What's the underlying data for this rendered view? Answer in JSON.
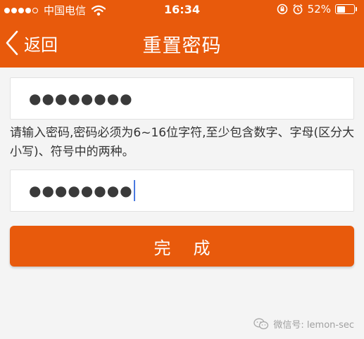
{
  "status_bar": {
    "carrier": "中国电信",
    "time": "16:34",
    "battery_text": "52%",
    "battery_level": 0.52,
    "signal_bars": 4,
    "signal_total": 5
  },
  "nav": {
    "back_label": "返回",
    "title": "重置密码"
  },
  "form": {
    "password_value": "●●●●●●●●",
    "confirm_value": "●●●●●●●●",
    "hint": "请输入密码,密码必须为6~16位字符,至少包含数字、字母(区分大小写)、符号中的两种。",
    "submit_label": "完成"
  },
  "watermark": {
    "text": "微信号: lemon-sec"
  },
  "colors": {
    "accent": "#e85a0c",
    "background": "#f4f4f4",
    "caret": "#4a7ae0"
  }
}
